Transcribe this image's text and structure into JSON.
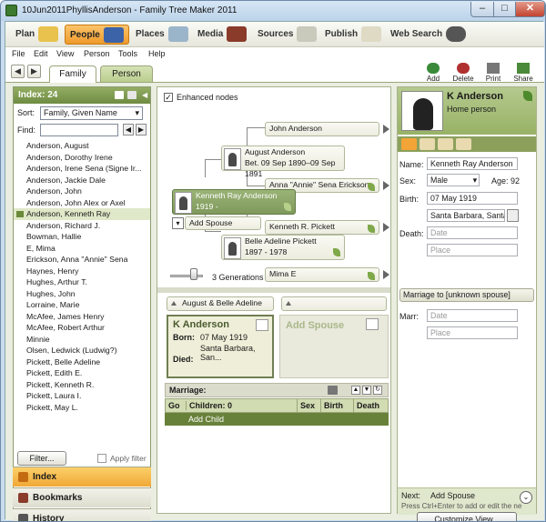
{
  "window": {
    "title": "10Jun2011PhyllisAnderson - Family Tree Maker 2011",
    "min": "–",
    "max": "□",
    "close": "✕"
  },
  "nav": {
    "tabs": [
      {
        "label": "Plan",
        "icon": "plan-icon"
      },
      {
        "label": "People",
        "icon": "people-icon",
        "active": true
      },
      {
        "label": "Places",
        "icon": "places-icon"
      },
      {
        "label": "Media",
        "icon": "media-icon"
      },
      {
        "label": "Sources",
        "icon": "sources-icon"
      },
      {
        "label": "Publish",
        "icon": "publish-icon"
      },
      {
        "label": "Web Search",
        "icon": "binoculars-icon"
      }
    ]
  },
  "menu": [
    "File",
    "Edit",
    "View",
    "Person",
    "Tools",
    "Help"
  ],
  "toolbar": {
    "back": "◀",
    "forward": "▶",
    "tab_family": "Family",
    "tab_person": "Person",
    "add": "Add",
    "delete": "Delete",
    "print": "Print",
    "share": "Share"
  },
  "index": {
    "title": "Index: 24",
    "sort_label": "Sort:",
    "sort_value": "Family, Given Name",
    "find_label": "Find:",
    "names": [
      "Anderson, August",
      "Anderson, Dorothy Irene",
      "Anderson, Irene Sena (Signe Ir...",
      "Anderson, Jackie Dale",
      "Anderson, John",
      "Anderson, John Alex or Axel",
      "Anderson, Kenneth Ray",
      "Anderson, Richard J.",
      "Bowman, Hallie",
      "E, Mima",
      "Erickson, Anna \"Annie\" Sena",
      "Haynes, Henry",
      "Hughes, Arthur T.",
      "Hughes, John",
      "Lorraine, Marie",
      "McAfee, James Henry",
      "McAfee, Robert Arthur",
      "Minnie",
      "Olsen, Ledwick (Ludwig?)",
      "Pickett, Belle Adeline",
      "Pickett, Edith E.",
      "Pickett, Kenneth R.",
      "Pickett, Laura I.",
      "Pickett, May L."
    ],
    "selected": 6,
    "filter": "Filter...",
    "apply_filter": "Apply filter"
  },
  "sidetabs": {
    "index": "Index",
    "bookmarks": "Bookmarks",
    "history": "History"
  },
  "tree": {
    "enhanced": "Enhanced nodes",
    "enhanced_check": "✓",
    "gf_father": "John Anderson",
    "father_name": "August Anderson",
    "father_dates": "Bet. 09 Sep 1890–09 Sep 1891",
    "gf_mother": "Anna \"Annie\" Sena Erickson",
    "home_name": "Kenneth Ray Anderson",
    "home_dates": "1919 -",
    "add_spouse": "Add Spouse",
    "gm_father": "Kenneth R. Pickett",
    "mother_name": "Belle Adeline Pickett",
    "mother_dates": "1897 - 1978",
    "gm_mother": "Mima E",
    "generations": "3 Generations"
  },
  "family": {
    "parents": "August & Belle Adeline",
    "person_name": "K Anderson",
    "born_label": "Born:",
    "born_date": "07 May 1919",
    "born_place": "Santa Barbara, San...",
    "died_label": "Died:",
    "spouse": "Add Spouse",
    "marriage_label": "Marriage:",
    "cols": [
      "Go",
      "Children: 0",
      "Sex",
      "Birth",
      "Death"
    ],
    "add_child": "Add Child"
  },
  "editor": {
    "name": "K Anderson",
    "subtitle": "Home person",
    "name_label": "Name:",
    "name_value": "Kenneth Ray Anderson",
    "sex_label": "Sex:",
    "sex_value": "Male",
    "age": "Age: 92",
    "birth_label": "Birth:",
    "birth_date": "07 May 1919",
    "birth_place": "Santa Barbara, Santa B",
    "death_label": "Death:",
    "date_ph": "Date",
    "place_ph": "Place",
    "marriage_btn": "Marriage to [unknown spouse]",
    "marr_label": "Marr:",
    "next_label": "Next:",
    "next_value": "Add Spouse",
    "next_hint": "Press Ctrl+Enter to add or edit the next pe",
    "customize": "Customize View..."
  },
  "colors": {
    "accent_orange": "#ef9a2c",
    "panel_green": "#6e8c41",
    "node_selected": "#8aa366"
  }
}
